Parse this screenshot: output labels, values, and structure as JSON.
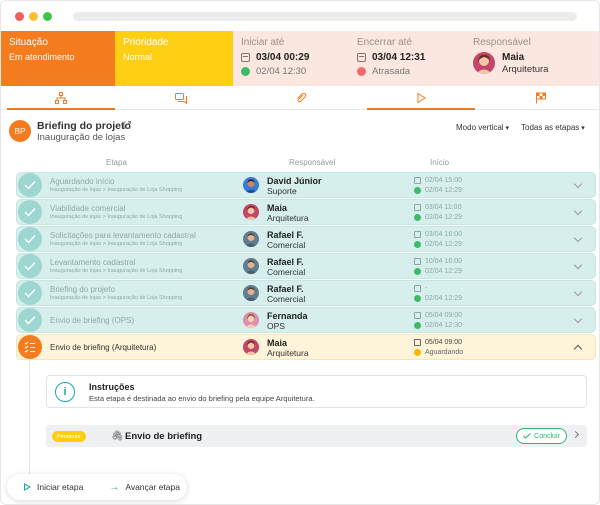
{
  "status": {
    "situacao": {
      "label": "Situação",
      "value": "Em atendimento",
      "color": "#f47b1e"
    },
    "prioridade": {
      "label": "Prioridade",
      "value": "Normal",
      "color": "#fccf12"
    },
    "iniciar": {
      "label": "Iniciar até",
      "planned": "03/04 00:29",
      "actual": "02/04 12:30"
    },
    "encerrar": {
      "label": "Encerrar até",
      "planned": "03/04 12:31",
      "state": "Atrasada"
    },
    "responsavel": {
      "label": "Responsável",
      "name": "Maia",
      "role": "Arquitetura"
    }
  },
  "tabs": [
    "structure-icon",
    "chat-icon",
    "attachment-icon",
    "play-icon",
    "flag-icon"
  ],
  "header": {
    "initials": "BP",
    "title": "Briefing do projeto",
    "subtitle": "Inauguração de lojas",
    "view_mode": "Modo vertical",
    "filter": "Todas as etapas"
  },
  "columns": {
    "etapa": "Etapa",
    "responsavel": "Responsável",
    "inicio": "Início"
  },
  "steps": [
    {
      "name": "Aguardando início",
      "path": "Inauguração de lojas > Inauguração de Loja Shopping",
      "resp": "David Júnior",
      "role": "Suporte",
      "d1": "02/04 15:00",
      "d2": "02/04 12:29"
    },
    {
      "name": "Viabilidade comercial",
      "path": "Inauguração de lojas > Inauguração de Loja Shopping",
      "resp": "Maia",
      "role": "Arquitetura",
      "d1": "03/04 11:00",
      "d2": "02/04 12:29"
    },
    {
      "name": "Solicitações para levantamento cadastral",
      "path": "Inauguração de lojas > Inauguração de Loja Shopping",
      "resp": "Rafael F.",
      "role": "Comercial",
      "d1": "03/04 16:00",
      "d2": "02/04 12:29"
    },
    {
      "name": "Levantamento cadastral",
      "path": "Inauguração de lojas > Inauguração de Loja Shopping",
      "resp": "Rafael F.",
      "role": "Comercial",
      "d1": "10/04 16:00",
      "d2": "02/04 12:29"
    },
    {
      "name": "Briefing do projeto",
      "path": "Inauguração de lojas > Inauguração de Loja Shopping",
      "resp": "Rafael F.",
      "role": "Comercial",
      "d1": "-",
      "d2": "02/04 12:29"
    },
    {
      "name": "Envio de briefing (OPS)",
      "path": "",
      "resp": "Fernanda",
      "role": "OPS",
      "d1": "05/04 09:00",
      "d2": "02/04 12:30"
    },
    {
      "name": "Envio de briefing (Arquitetura)",
      "path": "",
      "resp": "Maia",
      "role": "Arquitetura",
      "d1": "05/04 09:00",
      "d2": "Aguardando"
    }
  ],
  "instructions": {
    "title": "Instruções",
    "text": "Esta etapa é destinada ao envio do briefing pela equipe Arquitetura."
  },
  "task": {
    "badge": "Pendente",
    "name": "Envio de briefing",
    "action": "Concluir"
  },
  "footer": {
    "start": "Iniciar etapa",
    "advance": "Avançar etapa"
  }
}
